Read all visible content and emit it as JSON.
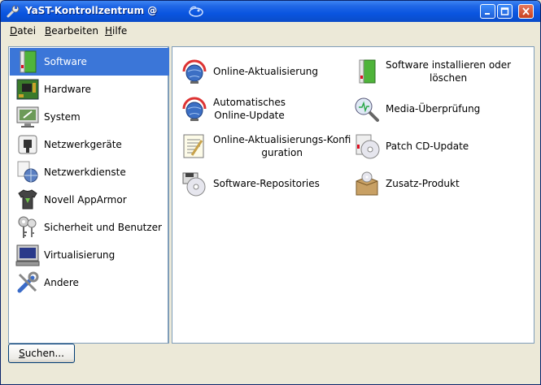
{
  "window": {
    "title": "YaST-Kontrollzentrum @",
    "colors": {
      "titlebar": "#0a55e0",
      "selection": "#3b76d8",
      "close_button": "#c8411f"
    }
  },
  "menubar": {
    "items": [
      {
        "mnemonic": "D",
        "rest": "atei"
      },
      {
        "mnemonic": "B",
        "rest": "earbeiten"
      },
      {
        "mnemonic": "H",
        "rest": "ilfe"
      }
    ]
  },
  "sidebar": {
    "selected": "Software",
    "items": [
      {
        "label": "Software",
        "icon": "software-icon"
      },
      {
        "label": "Hardware",
        "icon": "hardware-icon"
      },
      {
        "label": "System",
        "icon": "system-icon"
      },
      {
        "label": "Netzwerkgeräte",
        "icon": "network-devices-icon"
      },
      {
        "label": "Netzwerkdienste",
        "icon": "network-services-icon"
      },
      {
        "label": "Novell AppArmor",
        "icon": "apparmor-icon"
      },
      {
        "label": "Sicherheit und Benutzer",
        "icon": "security-users-icon"
      },
      {
        "label": "Virtualisierung",
        "icon": "virtualization-icon"
      },
      {
        "label": "Andere",
        "icon": "tools-icon"
      }
    ]
  },
  "modules": {
    "online_update": {
      "label": "Online-Aktualisierung",
      "icon": "globe-update-icon"
    },
    "auto_update": {
      "line1": "Automatisches",
      "line2": "Online-Update",
      "icon": "globe-update-icon"
    },
    "update_config": {
      "line1": "Online-Aktualisierungs-Konfi",
      "line2": "guration",
      "icon": "config-document-icon"
    },
    "repositories": {
      "label": "Software-Repositories",
      "icon": "repositories-icon"
    },
    "install_software": {
      "line1": "Software installieren oder",
      "line2": "löschen",
      "icon": "software-package-icon"
    },
    "media_check": {
      "label": "Media-Überprüfung",
      "icon": "media-check-icon"
    },
    "patch_cd": {
      "label": "Patch CD-Update",
      "icon": "patch-cd-icon"
    },
    "addon": {
      "label": "Zusatz-Produkt",
      "icon": "addon-product-icon"
    }
  },
  "search_button": {
    "mnemonic": "S",
    "rest": "uchen..."
  }
}
